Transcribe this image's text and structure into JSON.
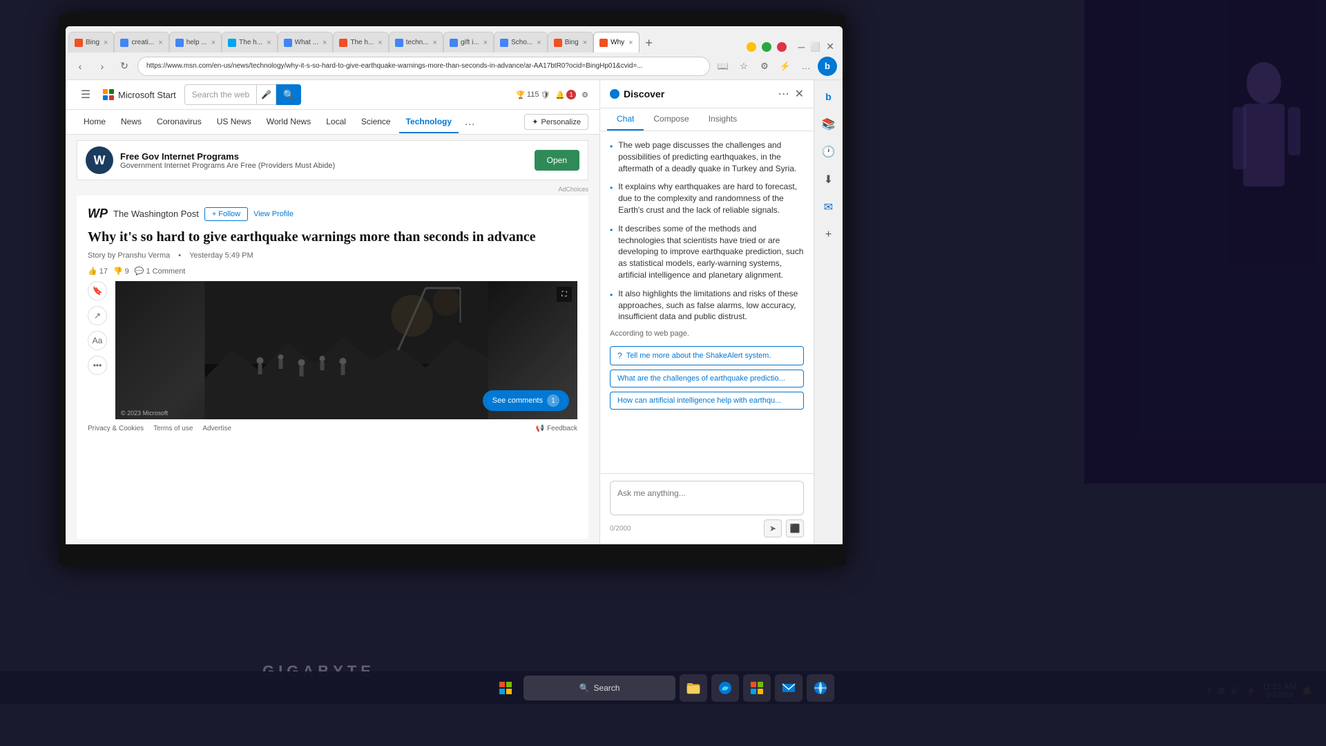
{
  "browser": {
    "tabs": [
      {
        "id": 1,
        "label": "Bing",
        "favicon": "B",
        "color": "#f05022",
        "active": false
      },
      {
        "id": 2,
        "label": "creati...",
        "favicon": "G",
        "color": "#4285f4",
        "active": false
      },
      {
        "id": 3,
        "label": "help ...",
        "favicon": "G",
        "color": "#4285f4",
        "active": false
      },
      {
        "id": 4,
        "label": "The h...",
        "favicon": "M",
        "color": "#00a4ef",
        "active": false
      },
      {
        "id": 5,
        "label": "What ...",
        "favicon": "G",
        "color": "#4285f4",
        "active": false
      },
      {
        "id": 6,
        "label": "The h...",
        "favicon": "B",
        "color": "#f05022",
        "active": false
      },
      {
        "id": 7,
        "label": "techn...",
        "favicon": "G",
        "color": "#4285f4",
        "active": false
      },
      {
        "id": 8,
        "label": "gift i...",
        "favicon": "G",
        "color": "#4285f4",
        "active": false
      },
      {
        "id": 9,
        "label": "Scho...",
        "favicon": "G",
        "color": "#4285f4",
        "active": false
      },
      {
        "id": 10,
        "label": "Bing",
        "favicon": "B",
        "color": "#f05022",
        "active": false
      },
      {
        "id": 11,
        "label": "Why",
        "favicon": "B",
        "color": "#f05022",
        "active": true
      }
    ],
    "url": "https://www.msn.com/en-us/news/technology/why-it-s-so-hard-to-give-earthquake-warnings-more-than-seconds-in-advance/ar-AA17btR0?ocid=BingHp01&cvid=..."
  },
  "msn": {
    "logo_text": "Microsoft Start",
    "search_placeholder": "Search the web",
    "nav_items": [
      "Home",
      "News",
      "Coronavirus",
      "US News",
      "World News",
      "Local",
      "Science",
      "Technology"
    ],
    "active_nav": "Technology",
    "personalize_label": "Personalize",
    "header_points": "115",
    "notification_count": "1"
  },
  "ad": {
    "logo_letter": "W",
    "title": "Free Gov Internet Programs",
    "subtitle": "Government Internet Programs Are Free (Providers Must Abide)",
    "cta_label": "Open",
    "adchoices": "AdChoices"
  },
  "article": {
    "source_logo": "WP",
    "source_name": "The Washington Post",
    "follow_label": "+ Follow",
    "view_profile_label": "View Profile",
    "title": "Why it's so hard to give earthquake warnings more than seconds in advance",
    "meta_author": "Story by Pranshu Verma",
    "meta_time": "Yesterday 5:49 PM",
    "likes": "17",
    "dislikes": "9",
    "comments": "1 Comment",
    "copyright": "© 2023 Microsoft",
    "privacy": "Privacy & Cookies",
    "terms": "Terms of use",
    "advertise": "Advertise",
    "feedback": "Feedback",
    "see_comments": "See comments",
    "comment_count": "1"
  },
  "discover": {
    "title": "Discover",
    "tabs": [
      "Chat",
      "Compose",
      "Insights"
    ],
    "active_tab": "Chat",
    "bullets": [
      "The web page discusses the challenges and possibilities of predicting earthquakes, in the aftermath of a deadly quake in Turkey and Syria.",
      "It explains why earthquakes are hard to forecast, due to the complexity and randomness of the Earth's crust and the lack of reliable signals.",
      "It describes some of the methods and technologies that scientists have tried or are developing to improve earthquake prediction, such as statistical models, early-warning systems, artificial intelligence and planetary alignment.",
      "It also highlights the limitations and risks of these approaches, such as false alarms, low accuracy, insufficient data and public distrust."
    ],
    "according_text": "According to web page.",
    "suggestions": [
      "Tell me more about the ShakeAlert system.",
      "What are the challenges of earthquake predictio...",
      "How can artificial intelligence help with earthqu..."
    ],
    "ask_placeholder": "Ask me anything...",
    "char_count": "0/2000",
    "more_options": "..."
  },
  "taskbar": {
    "start_icon": "⊞",
    "search_label": "Search",
    "time": "11:51 AM",
    "date": "2/7/2023",
    "icons": [
      "📁",
      "🌐",
      "📦",
      "📋",
      "🔵",
      "🌏"
    ]
  },
  "gigabyte_label": "GIGABYTE",
  "footer_links": {
    "privacy": "Privacy & Cookies",
    "terms": "Terms of use",
    "advertise": "Advertise",
    "feedback": "Feedback"
  }
}
